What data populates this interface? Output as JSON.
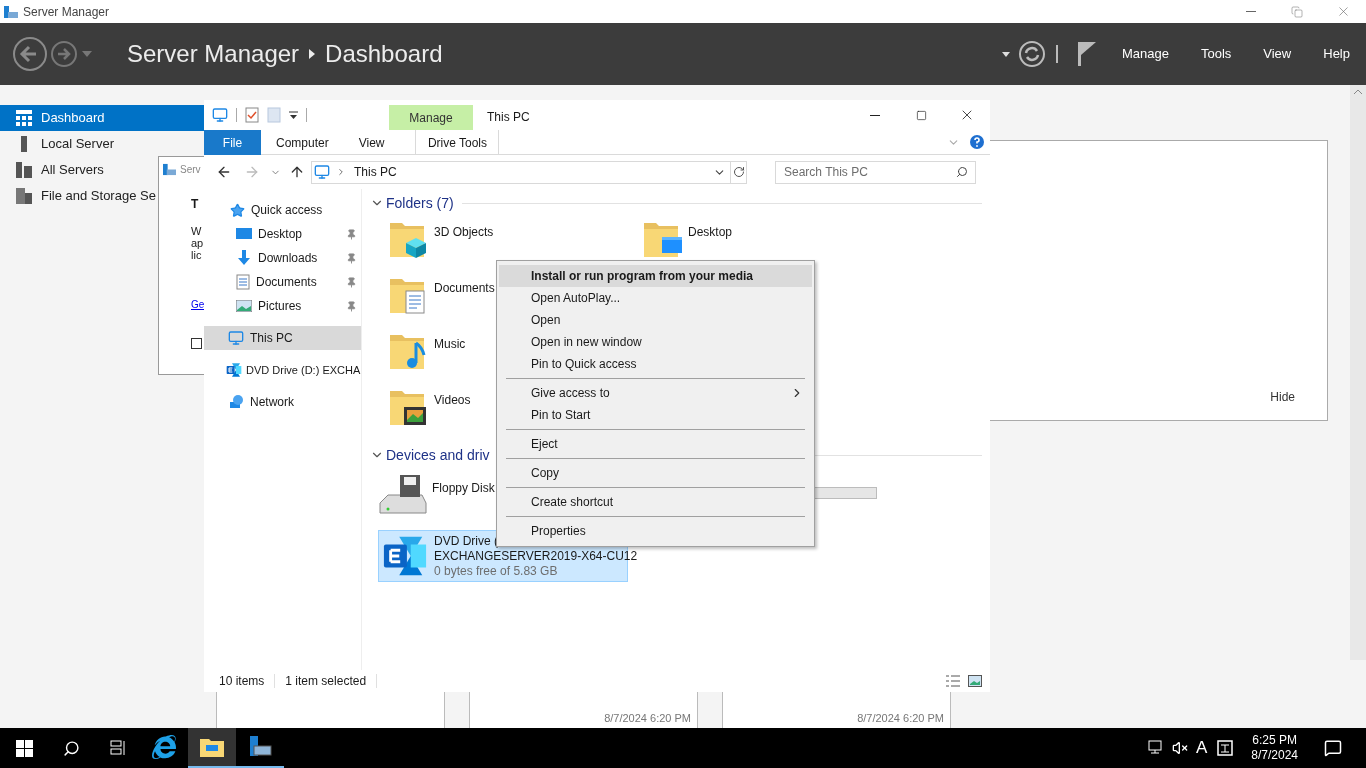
{
  "window": {
    "title": "Server Manager",
    "breadcrumb": [
      "Server Manager",
      "Dashboard"
    ],
    "menu": [
      "Manage",
      "Tools",
      "View",
      "Help"
    ]
  },
  "sidebar": {
    "items": [
      {
        "label": "Dashboard",
        "selected": true
      },
      {
        "label": "Local Server",
        "selected": false
      },
      {
        "label": "All Servers",
        "selected": false
      },
      {
        "label": "File and Storage Se",
        "selected": false
      }
    ]
  },
  "dashboard_panel": {
    "link": "Hide"
  },
  "tiles": [
    {
      "timestamp": "8/7/2024 6:20 PM"
    },
    {
      "timestamp": "8/7/2024 6:20 PM"
    }
  ],
  "dialog": {
    "title": "Serv",
    "heading": "T",
    "lines": [
      "W",
      "ap",
      "lic"
    ],
    "link": "Ge",
    "checkbox": {
      "checked": false
    }
  },
  "explorer": {
    "title": "This PC",
    "context_group": "Manage",
    "tabs": [
      {
        "label": "File",
        "kind": "file",
        "selected": false
      },
      {
        "label": "Computer",
        "kind": "plain",
        "selected": false
      },
      {
        "label": "View",
        "kind": "plain",
        "selected": false
      },
      {
        "label": "Drive Tools",
        "kind": "contextual",
        "selected": false
      }
    ],
    "address": {
      "path": "This PC"
    },
    "search": {
      "placeholder": "Search This PC"
    },
    "nav": [
      {
        "label": "Quick access",
        "selected": false,
        "children": [
          {
            "label": "Desktop",
            "pinned": true,
            "selected": false
          },
          {
            "label": "Downloads",
            "pinned": true,
            "selected": false
          },
          {
            "label": "Documents",
            "pinned": true,
            "selected": false
          },
          {
            "label": "Pictures",
            "pinned": true,
            "selected": false
          }
        ]
      },
      {
        "label": "This PC",
        "selected": true
      },
      {
        "label": "DVD Drive (D:) EXCHA",
        "selected": false
      },
      {
        "label": "Network",
        "selected": false
      }
    ],
    "folders": {
      "heading": "Folders (7)",
      "expanded": true,
      "items": [
        {
          "name": "3D Objects",
          "selected": false
        },
        {
          "name": "Desktop",
          "selected": false
        },
        {
          "name": "Documents",
          "selected": false
        },
        {
          "name": "Music",
          "selected": false
        },
        {
          "name": "Videos",
          "selected": false
        }
      ]
    },
    "devices": {
      "heading": "Devices and driv",
      "expanded": true,
      "items": [
        {
          "lines": [
            "Floppy Disk"
          ],
          "selected": false
        },
        {
          "lines": [
            "DVD Drive (",
            "EXCHANGESERVER2019-X64-CU12",
            "0 bytes free of 5.83 GB"
          ],
          "selected": true
        }
      ]
    },
    "status": [
      "10 items",
      "1 item selected"
    ]
  },
  "context_menu": {
    "items": [
      {
        "kind": "item",
        "label": "Install or run program from your media",
        "bold": true,
        "highlighted": true,
        "submenu": false
      },
      {
        "kind": "item",
        "label": "Open AutoPlay...",
        "bold": false,
        "highlighted": false,
        "submenu": false
      },
      {
        "kind": "item",
        "label": "Open",
        "bold": false,
        "highlighted": false,
        "submenu": false
      },
      {
        "kind": "item",
        "label": "Open in new window",
        "bold": false,
        "highlighted": false,
        "submenu": false
      },
      {
        "kind": "item",
        "label": "Pin to Quick access",
        "bold": false,
        "highlighted": false,
        "submenu": false
      },
      {
        "kind": "separator"
      },
      {
        "kind": "item",
        "label": "Give access to",
        "bold": false,
        "highlighted": false,
        "submenu": true
      },
      {
        "kind": "item",
        "label": "Pin to Start",
        "bold": false,
        "highlighted": false,
        "submenu": false
      },
      {
        "kind": "separator"
      },
      {
        "kind": "item",
        "label": "Eject",
        "bold": false,
        "highlighted": false,
        "submenu": false
      },
      {
        "kind": "separator"
      },
      {
        "kind": "item",
        "label": "Copy",
        "bold": false,
        "highlighted": false,
        "submenu": false
      },
      {
        "kind": "separator"
      },
      {
        "kind": "item",
        "label": "Create shortcut",
        "bold": false,
        "highlighted": false,
        "submenu": false
      },
      {
        "kind": "separator"
      },
      {
        "kind": "item",
        "label": "Properties",
        "bold": false,
        "highlighted": false,
        "submenu": false
      }
    ]
  },
  "taskbar": {
    "apps": [
      {
        "kind": "browser",
        "active": false,
        "running": false
      },
      {
        "kind": "files",
        "active": true,
        "running": true
      },
      {
        "kind": "server",
        "active": false,
        "running": true
      }
    ],
    "input_mode": "A",
    "time": "6:25 PM",
    "date": "8/7/2024"
  }
}
